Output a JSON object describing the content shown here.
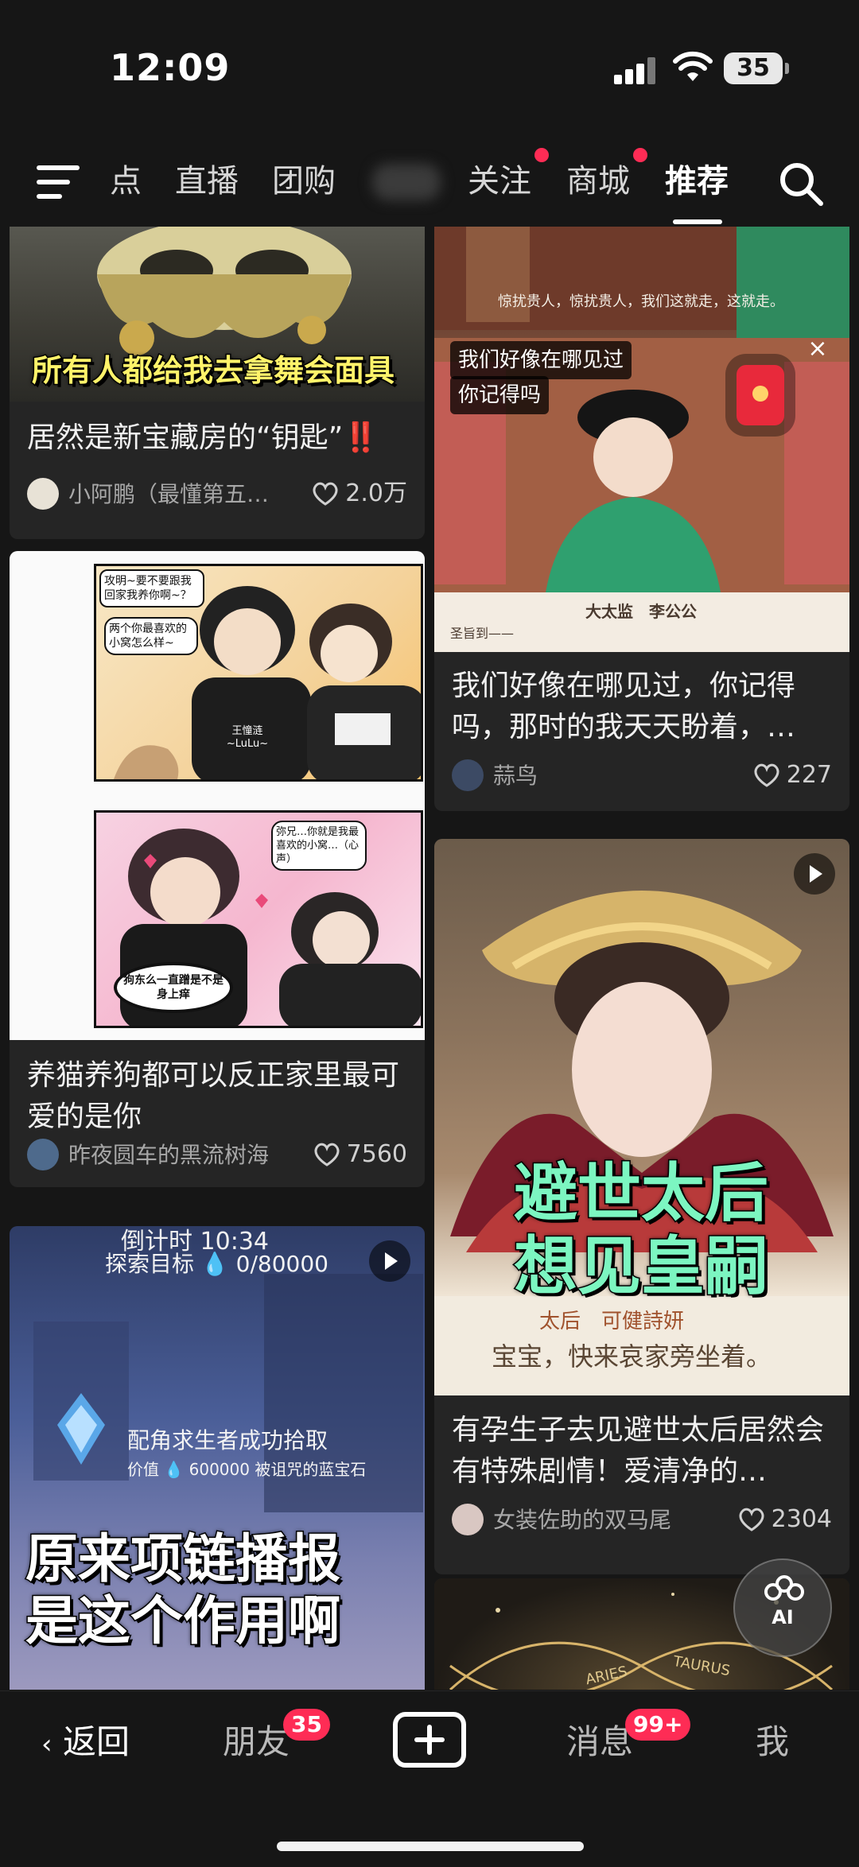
{
  "status_bar": {
    "time": "12:09",
    "battery": "35"
  },
  "top_nav": {
    "tabs": [
      {
        "label": "点"
      },
      {
        "label": "直播"
      },
      {
        "label": "团购"
      },
      {
        "label": "关注"
      },
      {
        "label": "商城"
      },
      {
        "label": "推荐"
      }
    ]
  },
  "feed": {
    "left": [
      {
        "overlay_text": "所有人都给我去拿舞会面具",
        "title": "居然是新宝藏房的“钥匙”‼️",
        "author": "小阿鹏（最懂第五…",
        "likes": "2.0万"
      },
      {
        "comic_bubbles": [
          "攻明~要不要跟我回家我养你啊~？",
          "两个你最喜欢的小窝怎么样~",
          "王憧涟 ~LuLu~",
          "弥兄…你就是我最喜欢的小窝…（心声）",
          "狗东么一直蹭是不是身上痒"
        ],
        "title": "养猫养狗都可以反正家里最可爱的是你",
        "author": "昨夜圆车的黑流树海",
        "likes": "7560"
      },
      {
        "hud_top": "倒计时 10:34",
        "hud_goal": "探索目标 💧 0/80000",
        "hud_msg": "配角求生者成功拾取",
        "hud_value": "价值 💧 600000  被诅咒的蓝宝石",
        "overlay_line1": "原来项链播报",
        "overlay_line2": "是这个作用啊"
      }
    ],
    "right": [
      {
        "scene_text": "惊扰贵人，惊扰贵人，我们这就走，这就走。",
        "chat_line1": "我们好像在哪见过",
        "chat_line2": "你记得吗",
        "scroll_text": "大太监　李公公",
        "decree_text": "圣旨到——",
        "title": "我们好像在哪见过，你记得吗，那时的我天天盼着，…",
        "author": "蒜鸟",
        "likes": "227"
      },
      {
        "overlay_line1": "避世太后",
        "overlay_line2": "想见皇嗣",
        "dialog_name": "太后　可健詩妍",
        "dialog_text": "宝宝，快来哀家旁坐着。",
        "title": "有孕生子去见避世太后居然会有特殊剧情！爱清净的…",
        "author": "女装佐助的双马尾",
        "likes": "2304"
      },
      {
        "zodiac1": "ARIES",
        "zodiac2": "TAURUS"
      }
    ]
  },
  "ai_button": {
    "label": "AI"
  },
  "bottom_nav": {
    "back": "返回",
    "friends": "朋友",
    "friends_badge": "35",
    "messages": "消息",
    "messages_badge": "99+",
    "me": "我"
  },
  "colors": {
    "accent": "#fe2c55",
    "background": "#161616",
    "card": "#252525"
  }
}
